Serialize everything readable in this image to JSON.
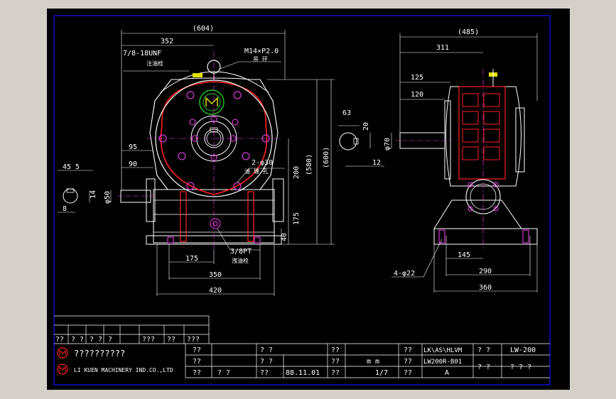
{
  "drawing": {
    "front": {
      "overall_width": "(604)",
      "dim_352": "352",
      "thread_note": "7/8-18UNF",
      "thread_sub": "注油栓",
      "eyebolt": "M14×P2.0",
      "eyebolt_sub": "吊 环",
      "dim_95": "95",
      "dim_90": "90",
      "dim_45": "45",
      "dim_5": "5",
      "dim_8": "8",
      "dim_14": "14",
      "dim_phi50": "φ50",
      "hole_note": "2-φ30",
      "hole_sub": "油 塘 孔",
      "dim_200": "200",
      "dim_580": "(580)",
      "dim_600": "(600)",
      "dim_175v": "175",
      "dim_40": "40",
      "dim_175h": "175",
      "dim_350": "350",
      "dim_420": "420",
      "drain": "3/8PT",
      "drain_sub": "洩油栓"
    },
    "side": {
      "overall_width": "(485)",
      "dim_311": "311",
      "dim_125": "125",
      "dim_120": "120",
      "dim_63": "63",
      "dim_20": "20",
      "dim_phi70": "φ70",
      "dim_12": "12",
      "dim_145": "145",
      "dim_290": "290",
      "dim_360": "360",
      "bolt_holes": "4-φ22"
    }
  },
  "title_block": {
    "rev_row": [
      "??",
      "? ?",
      "? ?",
      "?",
      "???",
      "??",
      "???"
    ],
    "company_cn": "??????????",
    "company_en": "LI KUEN MACHINERY IND.CO.,LTD",
    "cells": {
      "r1c1": "??",
      "r1c2": "? ?",
      "r1c3": "??",
      "r1c4": "??",
      "r1c5": "LK\\AS\\HLVM",
      "r1c6": "? ?",
      "r1c7": "LW-200",
      "r2c1": "??",
      "r2c2": "? ?",
      "r2c3": "??",
      "r2c4": "m m",
      "r2c5": "??",
      "r2c6": "LW200R-B01",
      "r3c1": "??",
      "r3c2": "? ?",
      "r3c3": "??",
      "r3c4": "88.11.01",
      "r3c5": "??",
      "r3c6": "1/7",
      "r3c7": "??",
      "r3c8": "A",
      "right1": "? ?",
      "right2": "? ? ?"
    }
  },
  "colors": {
    "frame": "#1010ff",
    "outline": "#ffffff",
    "red": "#ff2020",
    "magenta": "#ff40ff",
    "green": "#20c020",
    "yellow": "#e0e000"
  }
}
